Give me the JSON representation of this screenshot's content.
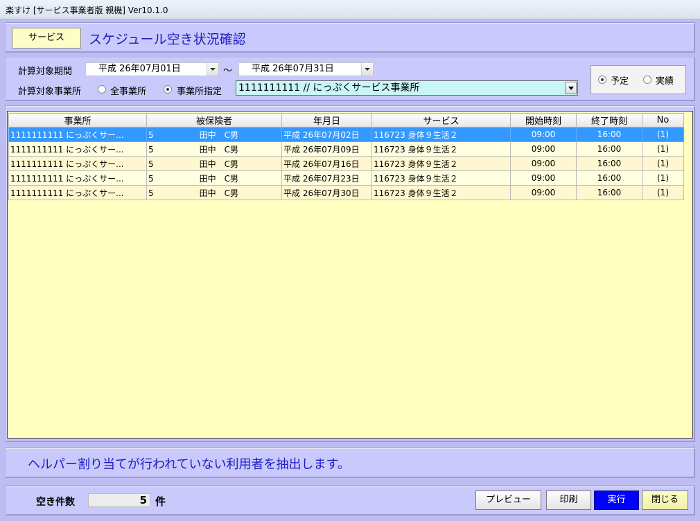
{
  "window": {
    "title": "楽すけ [サービス事業者版 親機] Ver10.1.0"
  },
  "header": {
    "service_button": "サービス",
    "screen_title": "スケジュール空き状況確認"
  },
  "filters": {
    "period_label": "計算対象期間",
    "period_from": "平成 26年07月01日",
    "period_sep": "～",
    "period_to": "平成 26年07月31日",
    "office_label": "計算対象事業所",
    "office_all_label": "全事業所",
    "office_specified_label": "事業所指定",
    "office_all_selected": false,
    "office_specified_selected": true,
    "office_value": "1111111111 // にっぷくサービス事業所"
  },
  "schedule_type": {
    "planned_label": "予定",
    "actual_label": "実績",
    "planned_selected": true,
    "actual_selected": false
  },
  "table": {
    "columns": [
      "事業所",
      "被保険者",
      "年月日",
      "サービス",
      "開始時刻",
      "終了時刻",
      "No"
    ],
    "rows": [
      {
        "office": "1111111111 にっぷくサー...",
        "ins_no": "5",
        "name": "田中　C男",
        "date": "平成 26年07月02日",
        "service": "116723 身体９生活２",
        "start": "09:00",
        "end": "16:00",
        "no": "(1)"
      },
      {
        "office": "1111111111 にっぷくサー...",
        "ins_no": "5",
        "name": "田中　C男",
        "date": "平成 26年07月09日",
        "service": "116723 身体９生活２",
        "start": "09:00",
        "end": "16:00",
        "no": "(1)"
      },
      {
        "office": "1111111111 にっぷくサー...",
        "ins_no": "5",
        "name": "田中　C男",
        "date": "平成 26年07月16日",
        "service": "116723 身体９生活２",
        "start": "09:00",
        "end": "16:00",
        "no": "(1)"
      },
      {
        "office": "1111111111 にっぷくサー...",
        "ins_no": "5",
        "name": "田中　C男",
        "date": "平成 26年07月23日",
        "service": "116723 身体９生活２",
        "start": "09:00",
        "end": "16:00",
        "no": "(1)"
      },
      {
        "office": "1111111111 にっぷくサー...",
        "ins_no": "5",
        "name": "田中　C男",
        "date": "平成 26年07月30日",
        "service": "116723 身体９生活２",
        "start": "09:00",
        "end": "16:00",
        "no": "(1)"
      }
    ],
    "selected_row": 0
  },
  "message": "ヘルパー割り当てが行われていない利用者を抽出します。",
  "footer": {
    "count_label": "空き件数",
    "count_value": "5",
    "count_unit": "件",
    "preview_button": "プレビュー",
    "print_button": "印刷",
    "run_button": "実行",
    "close_button": "閉じる"
  },
  "colors": {
    "background": "#bdbdf2",
    "panel": "#c9c9fb",
    "accent_text": "#1c1cc8",
    "grid_bg": "#ffffc0",
    "selection": "#3399ff",
    "run_button": "#0000ff"
  }
}
